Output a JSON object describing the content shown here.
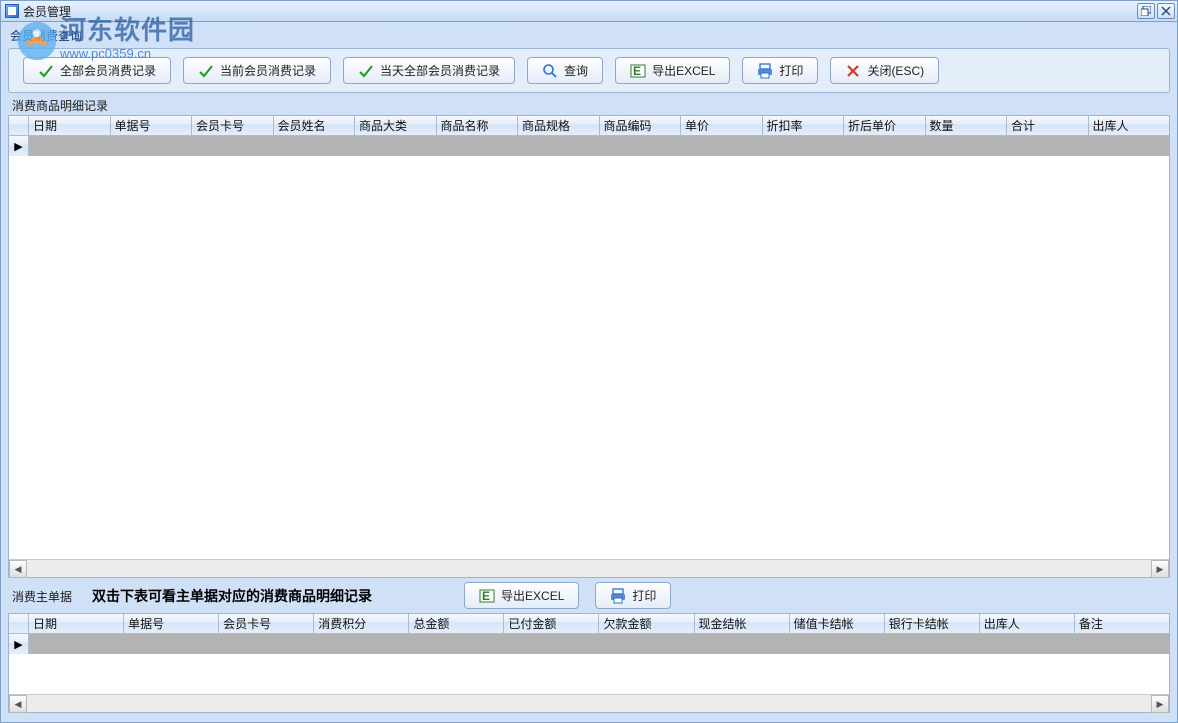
{
  "window": {
    "title": "会员管理"
  },
  "watermark": {
    "name": "河东软件园",
    "url": "www.pc0359.cn"
  },
  "group_label": "会员消费查询",
  "toolbar": {
    "all_records": "全部会员消费记录",
    "current_records": "当前会员消费记录",
    "today_records": "当天全部会员消费记录",
    "query": "查询",
    "export_excel": "导出EXCEL",
    "print": "打印",
    "close": "关闭(ESC)"
  },
  "detail_section": {
    "title": "消费商品明细记录",
    "columns": [
      "日期",
      "单据号",
      "会员卡号",
      "会员姓名",
      "商品大类",
      "商品名称",
      "商品规格",
      "商品编码",
      "单价",
      "折扣率",
      "折后单价",
      "数量",
      "合计",
      "出库人"
    ],
    "rows": []
  },
  "master_section": {
    "title": "消费主单据",
    "hint": "双击下表可看主单据对应的消费商品明细记录",
    "export_excel": "导出EXCEL",
    "print": "打印",
    "columns": [
      "日期",
      "单据号",
      "会员卡号",
      "消费积分",
      "总金额",
      "已付金额",
      "欠款金额",
      "现金结帐",
      "储值卡结帐",
      "银行卡结帐",
      "出库人",
      "备注"
    ],
    "rows": []
  }
}
